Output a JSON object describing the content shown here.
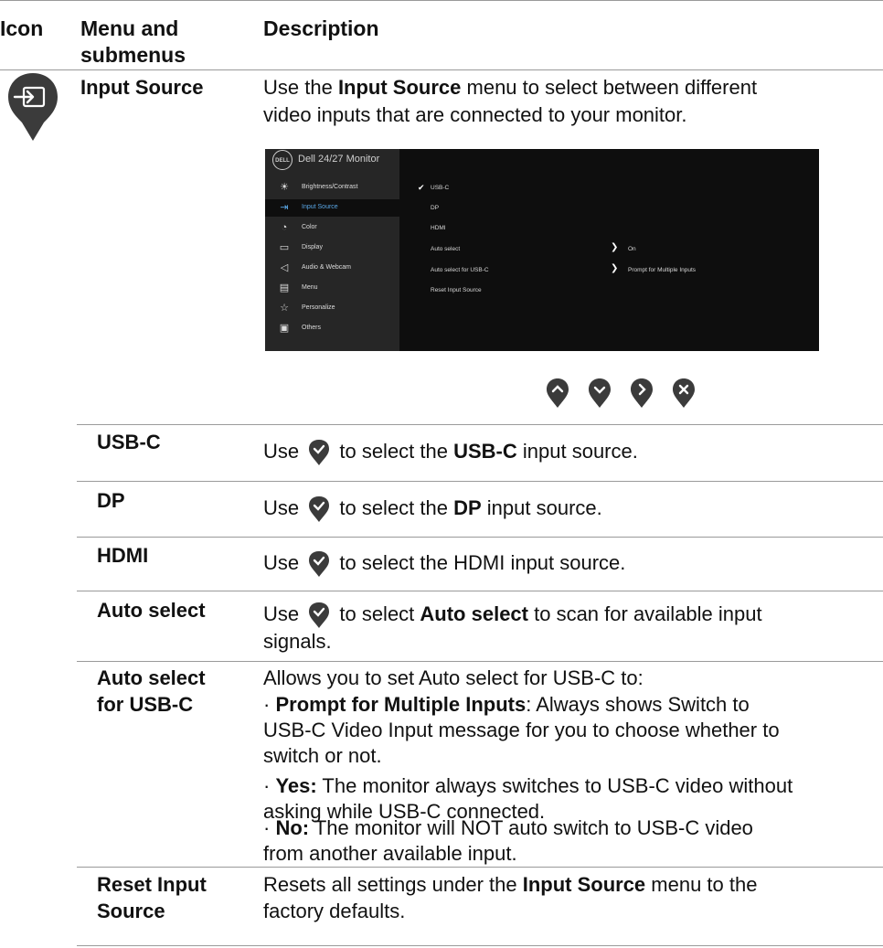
{
  "header": {
    "icon": "Icon",
    "menu_line1": "Menu and",
    "menu_line2": "submenus",
    "description": "Description"
  },
  "input_source": {
    "name": "Input Source",
    "desc_pre": "Use the ",
    "desc_bold": "Input Source",
    "desc_post": " menu to select between different",
    "desc_line2": "video inputs that are connected to your monitor.",
    "icon": "input-source-icon"
  },
  "osd": {
    "logo": "DELL",
    "title": "Dell 24/27 Monitor",
    "menu_items": [
      {
        "label": "Brightness/Contrast",
        "icon": "brightness-icon"
      },
      {
        "label": "Input Source",
        "icon": "input-icon"
      },
      {
        "label": "Color",
        "icon": "color-icon"
      },
      {
        "label": "Display",
        "icon": "display-icon"
      },
      {
        "label": "Audio & Webcam",
        "icon": "audio-icon"
      },
      {
        "label": "Menu",
        "icon": "menu-icon"
      },
      {
        "label": "Personalize",
        "icon": "star-icon"
      },
      {
        "label": "Others",
        "icon": "others-icon"
      }
    ],
    "options": [
      "USB-C",
      "DP",
      "HDMI",
      "Auto select",
      "Auto select for USB-C",
      "Reset Input Source"
    ],
    "auto_select_value": "On",
    "auto_select_usbc_value": "Prompt for Multiple Inputs",
    "nav_buttons": [
      "up-icon",
      "down-icon",
      "right-icon",
      "close-icon"
    ]
  },
  "rows": {
    "usbc": {
      "name": "USB-C",
      "pre": "Use ",
      "mid": " to select the ",
      "bold": "USB-C",
      "post": " input source."
    },
    "dp": {
      "name": "DP",
      "pre": "Use ",
      "mid": " to select the ",
      "bold": "DP",
      "post": " input source."
    },
    "hdmi": {
      "name": "HDMI",
      "pre": "Use ",
      "mid": " to select the ",
      "bold": "HDMI",
      "post": " input source."
    },
    "auto": {
      "name": "Auto select",
      "pre": "Use ",
      "mid": " to select ",
      "bold": "Auto select",
      "post": " to scan for available input",
      "line2": "signals."
    },
    "auto_usbc": {
      "name1": "Auto select",
      "name2": "for USB-C",
      "intro": "Allows you to set Auto select for USB-C to:",
      "b1_bold": "Prompt for Multiple Inputs",
      "b1_rest": ": Always shows Switch to",
      "b1_l2": "USB-C Video Input message for you to choose whether to",
      "b1_l3": "switch or not.",
      "b2_bold": "Yes:",
      "b2_rest": " The monitor always switches to USB-C video without",
      "b2_l2": "asking while USB-C connected.",
      "b3_bold": "No:",
      "b3_rest": " The monitor will NOT auto switch to USB-C video",
      "b3_l2": "from another available input."
    },
    "reset": {
      "name1": "Reset Input",
      "name2": "Source",
      "pre": "Resets all settings under the ",
      "bold": "Input Source",
      "post": " menu to the",
      "line2": "factory defaults."
    }
  },
  "colors": {
    "accent": "#3a3a3a",
    "osd_highlight": "#5aa7e6"
  }
}
